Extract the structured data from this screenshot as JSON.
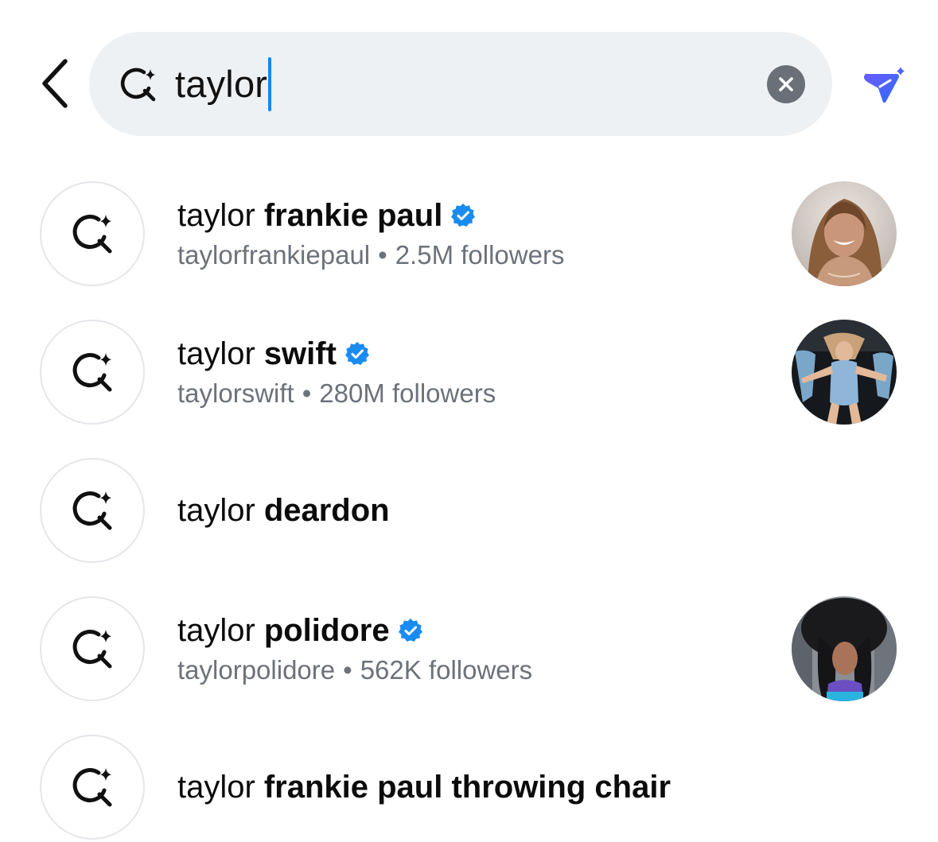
{
  "search": {
    "query": "taylor"
  },
  "results": [
    {
      "query_part": "taylor",
      "completion": "frankie paul",
      "verified": true,
      "username": "taylorfrankiepaul",
      "followers": "2.5M followers"
    },
    {
      "query_part": "taylor",
      "completion": "swift",
      "verified": true,
      "username": "taylorswift",
      "followers": "280M followers"
    },
    {
      "query_part": "taylor",
      "completion": "deardon",
      "verified": false
    },
    {
      "query_part": "taylor",
      "completion": "polidore",
      "verified": true,
      "username": "taylorpolidore",
      "followers": "562K followers"
    },
    {
      "query_part": "taylor",
      "completion": "frankie paul throwing chair",
      "verified": false
    }
  ],
  "separator": "•",
  "colors": {
    "accent_blue": "#1685f2",
    "verified_blue": "#1a8cf1",
    "ai_send_gradient": [
      "#6a5cff",
      "#2f6bff"
    ],
    "search_bg": "#eef1f4",
    "muted_text": "#6c727a"
  },
  "icons": {
    "back": "chevron-left-icon",
    "search": "ai-sparkle-search-icon",
    "clear": "clear-x-icon",
    "send_ai": "ai-send-icon",
    "verified": "verified-badge-icon"
  }
}
